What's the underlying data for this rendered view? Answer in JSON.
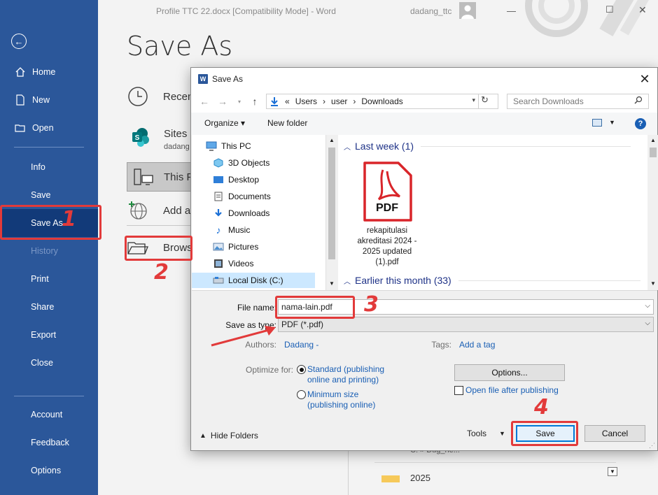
{
  "word": {
    "window_title": "Profile TTC 22.docx [Compatibility Mode]  -  Word",
    "user_name": "dadang_ttc",
    "page_title": "Save As",
    "sidebar": {
      "home": "Home",
      "new": "New",
      "open": "Open",
      "info": "Info",
      "save": "Save",
      "save_as": "Save As",
      "history": "History",
      "print": "Print",
      "share": "Share",
      "export": "Export",
      "close": "Close",
      "account": "Account",
      "feedback": "Feedback",
      "options": "Options"
    },
    "locations": {
      "recent": "Recen",
      "sites": "Sites -",
      "sites_sub": "dadang",
      "this_pc": "This P",
      "add_place": "Add a",
      "browse": "Brows"
    },
    "behind_list": {
      "path_fragment": "C: » Dug_rie...",
      "folder_2025": "2025"
    }
  },
  "annotations": [
    "1",
    "2",
    "3",
    "4"
  ],
  "dialog": {
    "title": "Save As",
    "close_glyph": "✕",
    "breadcrumb": [
      "«",
      "Users",
      "›",
      "user",
      "›",
      "Downloads"
    ],
    "search_placeholder": "Search Downloads",
    "toolbar": {
      "organize": "Organize ▾",
      "new_folder": "New folder"
    },
    "nav_tree": [
      "This PC",
      "3D Objects",
      "Desktop",
      "Documents",
      "Downloads",
      "Music",
      "Pictures",
      "Videos",
      "Local Disk (C:)"
    ],
    "groups": {
      "last_week": "Last week (1)",
      "earlier": "Earlier this month (33)"
    },
    "file": {
      "badge": "PDF",
      "name": "rekapitulasi akreditasi 2024 - 2025 updated (1).pdf"
    },
    "form": {
      "file_name_label": "File name:",
      "file_name_value": "nama-lain.pdf",
      "save_type_label": "Save as type:",
      "save_type_value": "PDF (*.pdf)",
      "authors_label": "Authors:",
      "authors_value": "Dadang -",
      "tags_label": "Tags:",
      "tags_value": "Add a tag",
      "optimize_label": "Optimize for:",
      "opt_standard": "Standard (publishing online and printing)",
      "opt_minimum": "Minimum size (publishing online)",
      "options_button": "Options...",
      "open_after": "Open file after publishing"
    },
    "footer": {
      "hide_folders": "Hide Folders",
      "tools": "Tools",
      "save": "Save",
      "cancel": "Cancel"
    }
  },
  "colors": {
    "word_blue": "#2b579a",
    "active_nav": "#123a79",
    "annotation_red": "#e23a3a",
    "pdf_red": "#d9252a",
    "link_blue": "#1a5fb4"
  }
}
